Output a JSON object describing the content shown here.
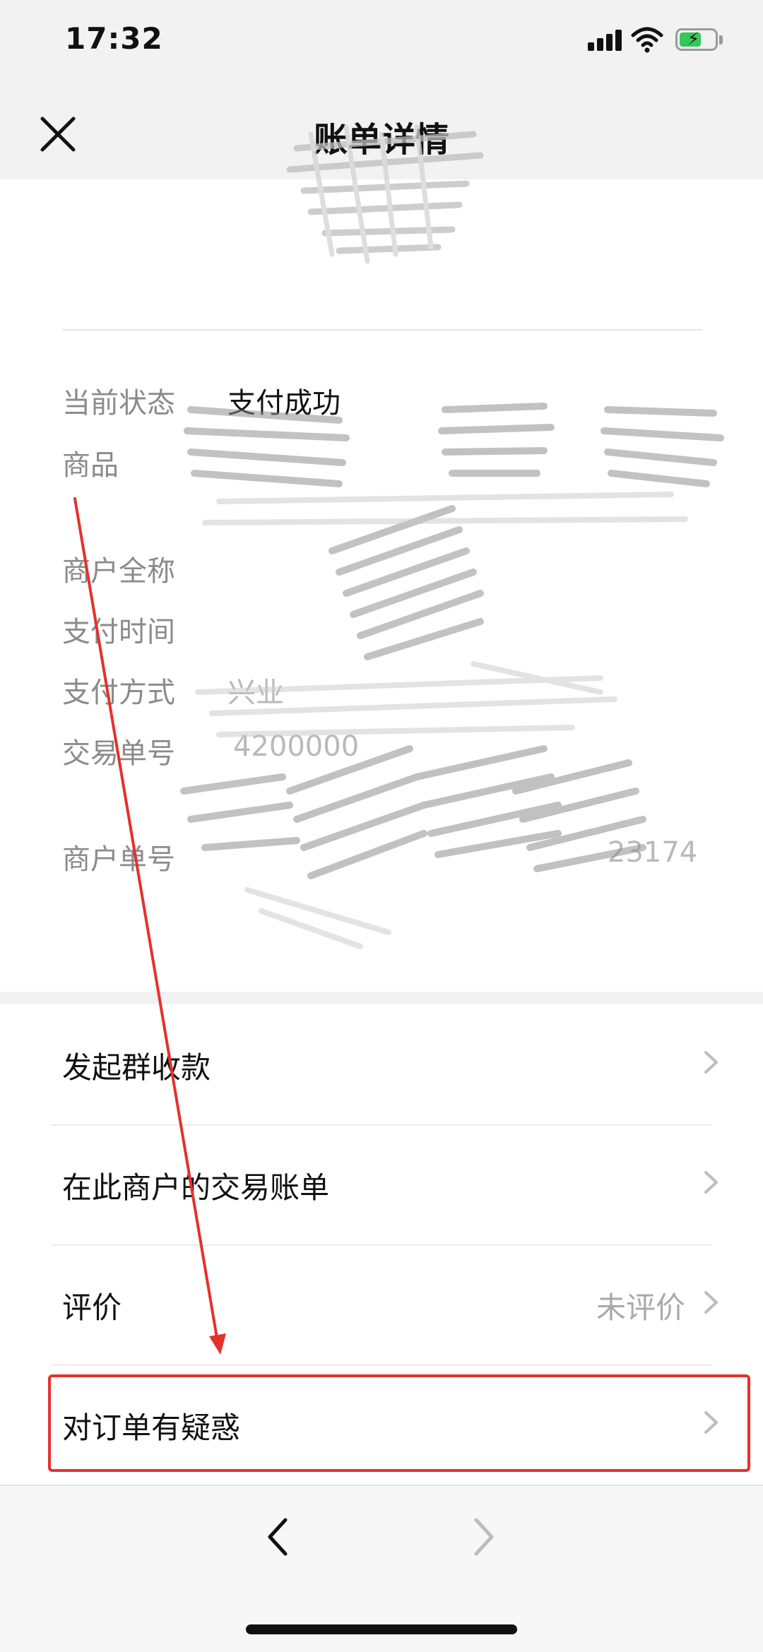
{
  "status_bar": {
    "time": "17:32",
    "signal_icon": "signal-bars-icon",
    "wifi_icon": "wifi-icon",
    "battery_icon": "battery-charging-icon"
  },
  "nav": {
    "title": "账单详情",
    "close_icon": "close-icon"
  },
  "details": {
    "status_label": "当前状态",
    "status_value": "支付成功",
    "product_label": "商品",
    "merchant_label": "商户全称",
    "pay_time_label": "支付时间",
    "pay_method_label": "支付方式",
    "pay_method_value_partial": "兴业",
    "transaction_no_label": "交易单号",
    "transaction_no_partial": "4200000",
    "merchant_order_label": "商户单号",
    "merchant_order_partial": "23174"
  },
  "actions": {
    "group_collect": "发起群收款",
    "merchant_bills": "在此商户的交易账单",
    "rating": "评价",
    "rating_value": "未评价",
    "order_question": "对订单有疑惑",
    "chevron_icon": "chevron-right-icon"
  },
  "bottom_bar": {
    "back_icon": "chevron-left-icon",
    "forward_icon": "chevron-right-icon"
  },
  "colors": {
    "annotation_red": "#e3322e",
    "battery_green": "#35c759",
    "label_gray": "#8b8b8b"
  }
}
